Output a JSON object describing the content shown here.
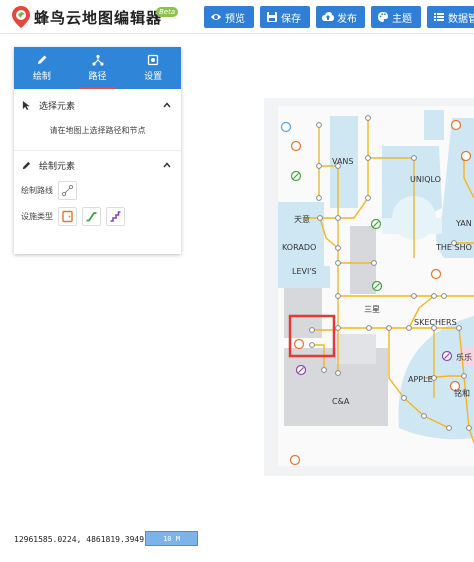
{
  "header": {
    "title": "蜂鸟云地图编辑器",
    "badge": "Beta",
    "buttons": [
      {
        "label": "预览",
        "icon": "eye-icon"
      },
      {
        "label": "保存",
        "icon": "save-icon"
      },
      {
        "label": "发布",
        "icon": "cloud-upload-icon"
      },
      {
        "label": "主题",
        "icon": "palette-icon"
      },
      {
        "label": "数据管",
        "icon": "list-icon"
      }
    ]
  },
  "panel": {
    "tabs": [
      {
        "label": "绘制",
        "icon": "pencil-icon"
      },
      {
        "label": "路径",
        "icon": "path-icon",
        "active": true
      },
      {
        "label": "设置",
        "icon": "settings-icon"
      }
    ],
    "select_section": {
      "title": "选择元素",
      "hint": "请在地图上选择路径和节点"
    },
    "draw_section": {
      "title": "绘制元素",
      "draw_path_label": "绘制路线",
      "facility_type_label": "设施类型"
    }
  },
  "map": {
    "labels": {
      "vans": "VANS",
      "uniqlo": "UNIQLO",
      "tianyi": "天意",
      "korador": "KORADO",
      "levis": "LEVI'S",
      "sanxing": "三星",
      "skechers": "SKECHERS",
      "apple": "APPLE",
      "canda": "C&A",
      "theshop": "THE SHO",
      "yan": "YAN",
      "lexing": "乐乐",
      "lianyu": "铭和"
    },
    "colors": {
      "path": "#f5b521",
      "store_blue": "#cfe7f3",
      "store_gray": "#d6d8db",
      "highlight": "#e53935"
    }
  },
  "footer": {
    "coordinates": "12961585.0224, 4861819.3949",
    "scale": "10 M"
  }
}
